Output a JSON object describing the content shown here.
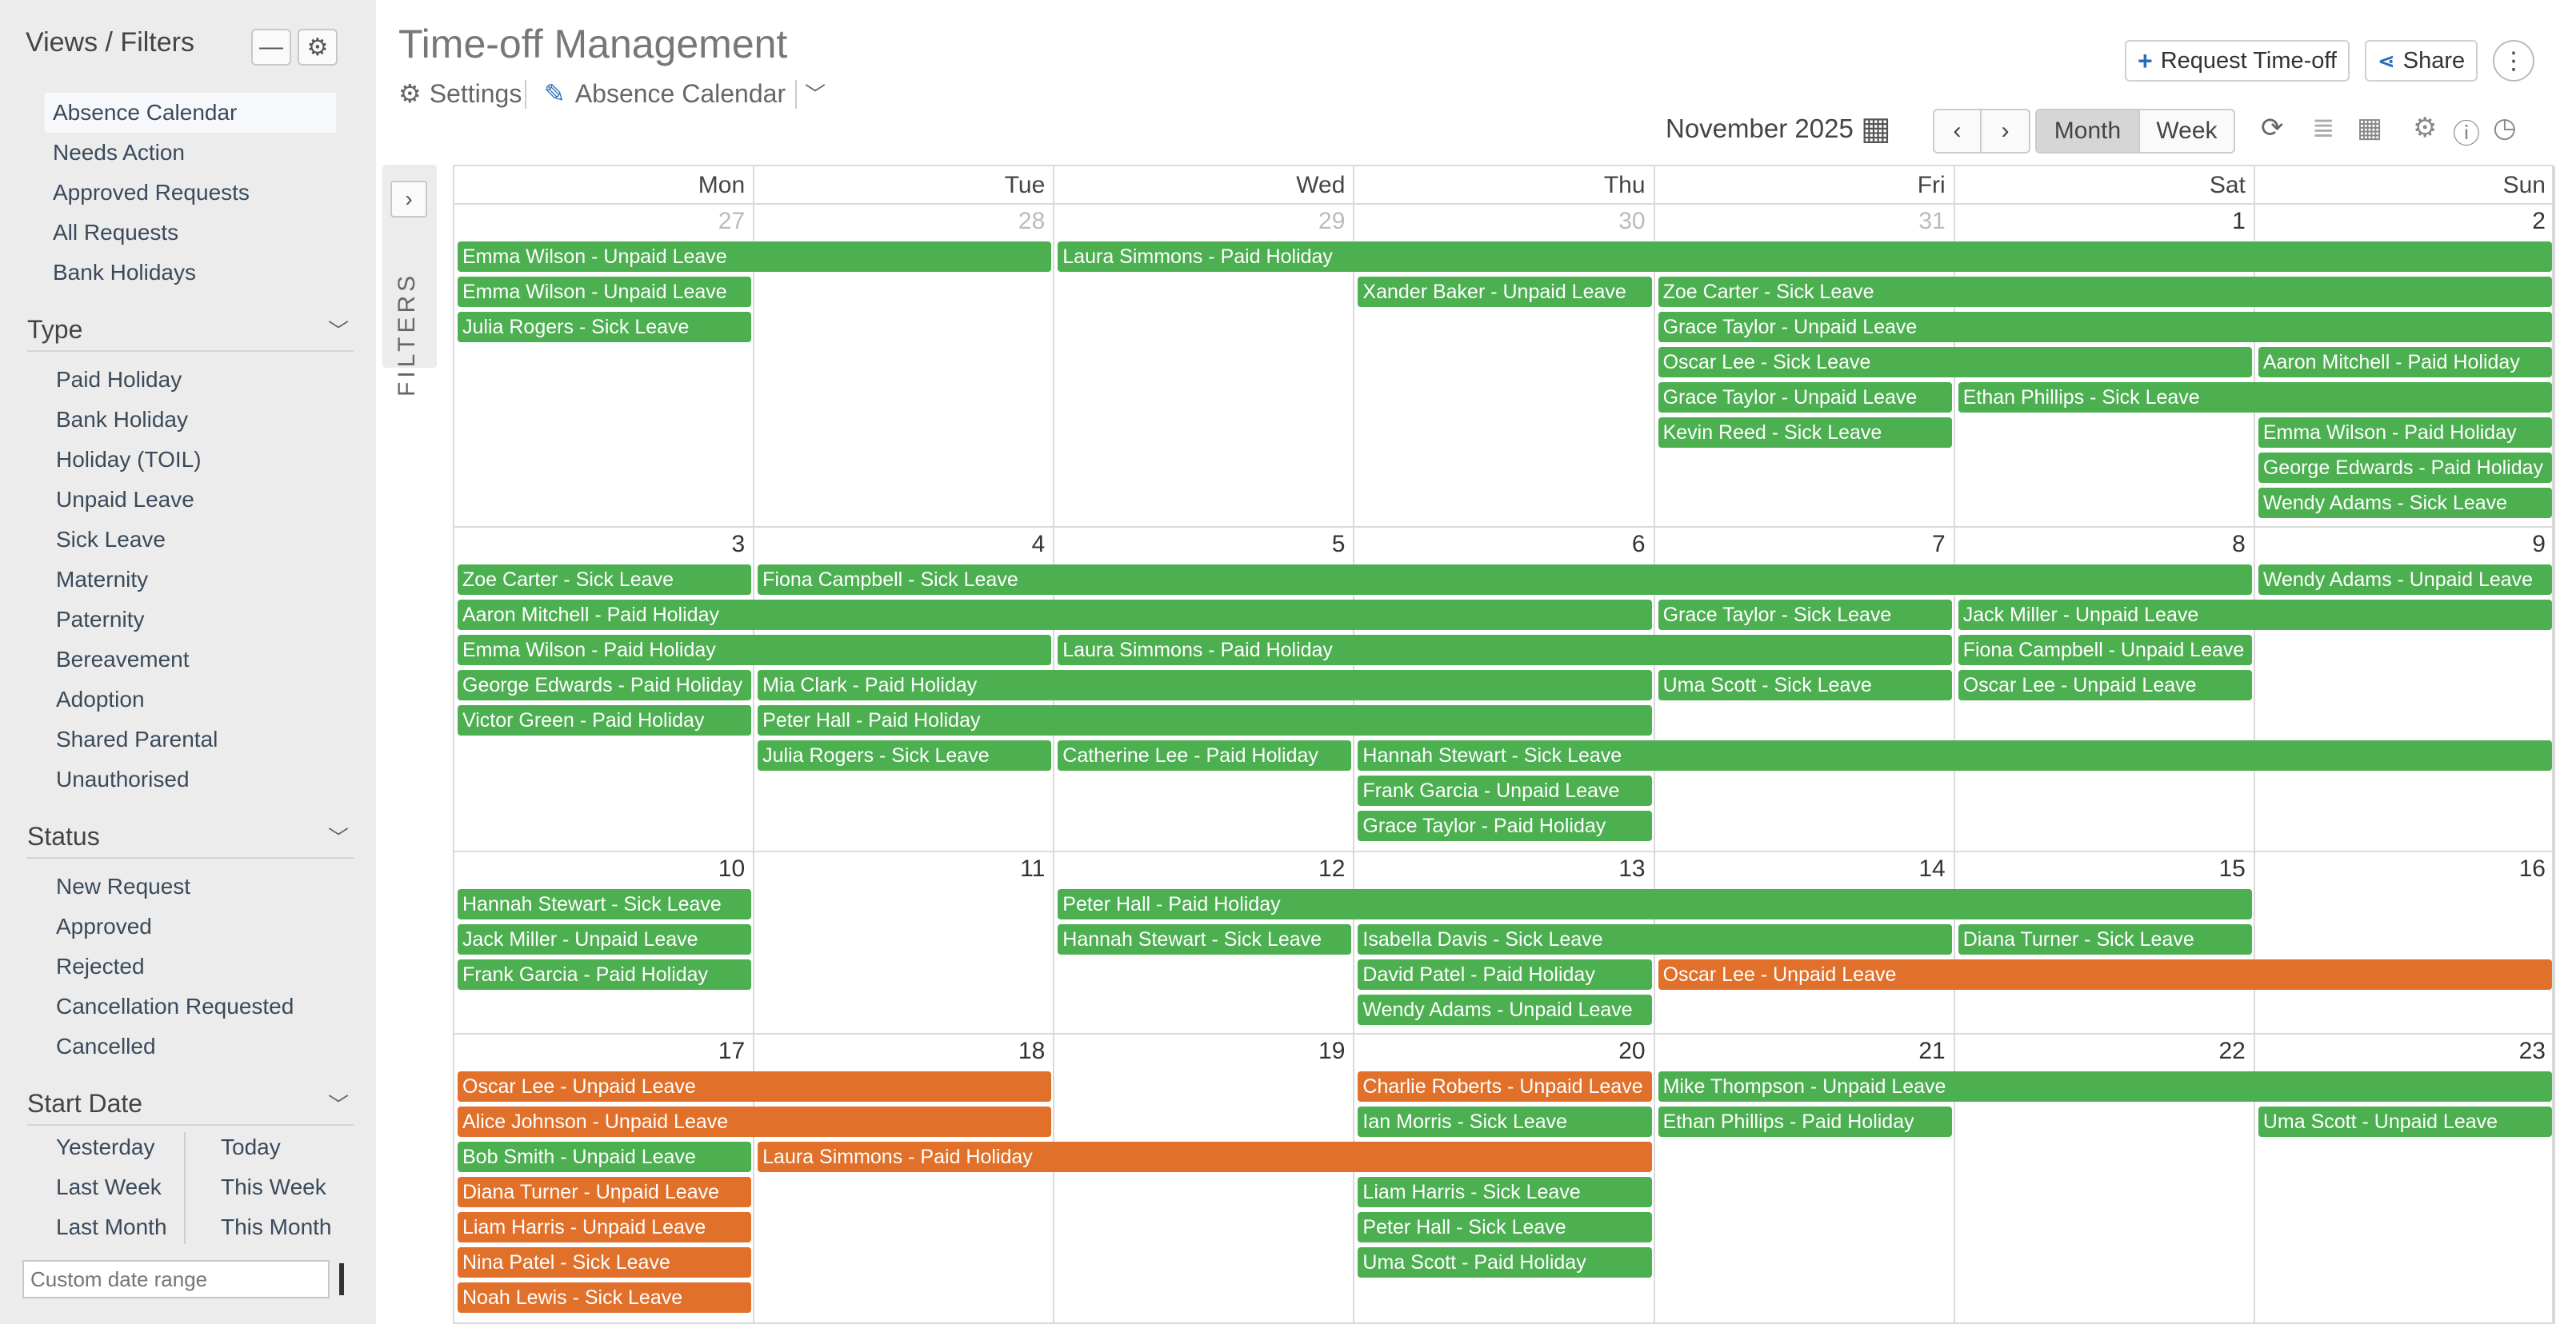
{
  "sidebar": {
    "title": "Views / Filters",
    "views": [
      "Absence Calendar",
      "Needs Action",
      "Approved Requests",
      "All Requests",
      "Bank Holidays"
    ],
    "type_title": "Type",
    "types": [
      "Paid Holiday",
      "Bank Holiday",
      "Holiday (TOIL)",
      "Unpaid Leave",
      "Sick Leave",
      "Maternity",
      "Paternity",
      "Bereavement",
      "Adoption",
      "Shared Parental",
      "Unauthorised"
    ],
    "status_title": "Status",
    "statuses": [
      "New Request",
      "Approved",
      "Rejected",
      "Cancellation Requested",
      "Cancelled"
    ],
    "start_title": "Start Date",
    "dates_left": [
      "Yesterday",
      "Last Week",
      "Last Month"
    ],
    "dates_right": [
      "Today",
      "This Week",
      "This Month"
    ],
    "range_placeholder": "Custom date range"
  },
  "filters_tab": {
    "label": "FILTERS"
  },
  "header": {
    "title": "Time-off Management",
    "settings": "Settings",
    "view_name": "Absence Calendar",
    "request_btn": "Request Time-off",
    "share_btn": "Share",
    "month": "November 2025",
    "month_btn": "Month",
    "week_btn": "Week"
  },
  "colors": {
    "approved": "#4caf50",
    "pending": "#e0702a",
    "accent": "#2a6eb5"
  },
  "calendar": {
    "days": [
      "Mon",
      "Tue",
      "Wed",
      "Thu",
      "Fri",
      "Sat",
      "Sun"
    ],
    "weeks": [
      {
        "dates": [
          "27",
          "28",
          "29",
          "30",
          "31",
          "1",
          "2"
        ],
        "muted": [
          true,
          true,
          true,
          true,
          true,
          false,
          false
        ],
        "events": [
          {
            "text": "Emma Wilson - Unpaid Leave",
            "start": 0,
            "span": 2,
            "slot": 0,
            "color": "green"
          },
          {
            "text": "Laura Simmons - Paid Holiday",
            "start": 2,
            "span": 5,
            "slot": 0,
            "color": "green"
          },
          {
            "text": "Emma Wilson - Unpaid Leave",
            "start": 0,
            "span": 1,
            "slot": 1,
            "color": "green"
          },
          {
            "text": "Xander Baker - Unpaid Leave",
            "start": 3,
            "span": 1,
            "slot": 1,
            "color": "green"
          },
          {
            "text": "Zoe Carter - Sick Leave",
            "start": 4,
            "span": 3,
            "slot": 1,
            "color": "green"
          },
          {
            "text": "Julia Rogers - Sick Leave",
            "start": 0,
            "span": 1,
            "slot": 2,
            "color": "green"
          },
          {
            "text": "Grace Taylor - Unpaid Leave",
            "start": 4,
            "span": 3,
            "slot": 2,
            "color": "green"
          },
          {
            "text": "Oscar Lee - Sick Leave",
            "start": 4,
            "span": 2,
            "slot": 3,
            "color": "green"
          },
          {
            "text": "Aaron Mitchell - Paid Holiday",
            "start": 6,
            "span": 1,
            "slot": 3,
            "color": "green"
          },
          {
            "text": "Grace Taylor - Unpaid Leave",
            "start": 4,
            "span": 1,
            "slot": 4,
            "color": "green"
          },
          {
            "text": "Ethan Phillips - Sick Leave",
            "start": 5,
            "span": 2,
            "slot": 4,
            "color": "green"
          },
          {
            "text": "Kevin Reed - Sick Leave",
            "start": 4,
            "span": 1,
            "slot": 5,
            "color": "green"
          },
          {
            "text": "Emma Wilson - Paid Holiday",
            "start": 6,
            "span": 1,
            "slot": 5,
            "color": "green"
          },
          {
            "text": "George Edwards - Paid Holiday",
            "start": 6,
            "span": 1,
            "slot": 6,
            "color": "green"
          },
          {
            "text": "Wendy Adams - Sick Leave",
            "start": 6,
            "span": 1,
            "slot": 7,
            "color": "green"
          }
        ]
      },
      {
        "dates": [
          "3",
          "4",
          "5",
          "6",
          "7",
          "8",
          "9"
        ],
        "muted": [
          false,
          false,
          false,
          false,
          false,
          false,
          false
        ],
        "events": [
          {
            "text": "Zoe Carter - Sick Leave",
            "start": 0,
            "span": 1,
            "slot": 0,
            "color": "green"
          },
          {
            "text": "Fiona Campbell - Sick Leave",
            "start": 1,
            "span": 5,
            "slot": 0,
            "color": "green"
          },
          {
            "text": "Wendy Adams - Unpaid Leave",
            "start": 6,
            "span": 1,
            "slot": 0,
            "color": "green"
          },
          {
            "text": "Aaron Mitchell - Paid Holiday",
            "start": 0,
            "span": 4,
            "slot": 1,
            "color": "green"
          },
          {
            "text": "Grace Taylor - Sick Leave",
            "start": 4,
            "span": 1,
            "slot": 1,
            "color": "green"
          },
          {
            "text": "Jack Miller - Unpaid Leave",
            "start": 5,
            "span": 2,
            "slot": 1,
            "color": "green"
          },
          {
            "text": "Emma Wilson - Paid Holiday",
            "start": 0,
            "span": 2,
            "slot": 2,
            "color": "green"
          },
          {
            "text": "Laura Simmons - Paid Holiday",
            "start": 2,
            "span": 3,
            "slot": 2,
            "color": "green"
          },
          {
            "text": "Fiona Campbell - Unpaid Leave",
            "start": 5,
            "span": 1,
            "slot": 2,
            "color": "green"
          },
          {
            "text": "George Edwards - Paid Holiday",
            "start": 0,
            "span": 1,
            "slot": 3,
            "color": "green"
          },
          {
            "text": "Mia Clark - Paid Holiday",
            "start": 1,
            "span": 3,
            "slot": 3,
            "color": "green"
          },
          {
            "text": "Uma Scott - Sick Leave",
            "start": 4,
            "span": 1,
            "slot": 3,
            "color": "green"
          },
          {
            "text": "Oscar Lee - Unpaid Leave",
            "start": 5,
            "span": 1,
            "slot": 3,
            "color": "green"
          },
          {
            "text": "Victor Green - Paid Holiday",
            "start": 0,
            "span": 1,
            "slot": 4,
            "color": "green"
          },
          {
            "text": "Peter Hall - Paid Holiday",
            "start": 1,
            "span": 3,
            "slot": 4,
            "color": "green"
          },
          {
            "text": "Julia Rogers - Sick Leave",
            "start": 1,
            "span": 1,
            "slot": 5,
            "color": "green"
          },
          {
            "text": "Catherine Lee - Paid Holiday",
            "start": 2,
            "span": 1,
            "slot": 5,
            "color": "green"
          },
          {
            "text": "Hannah Stewart - Sick Leave",
            "start": 3,
            "span": 4,
            "slot": 5,
            "color": "green"
          },
          {
            "text": "Frank Garcia - Unpaid Leave",
            "start": 3,
            "span": 1,
            "slot": 6,
            "color": "green"
          },
          {
            "text": "Grace Taylor - Paid Holiday",
            "start": 3,
            "span": 1,
            "slot": 7,
            "color": "green"
          }
        ]
      },
      {
        "dates": [
          "10",
          "11",
          "12",
          "13",
          "14",
          "15",
          "16"
        ],
        "muted": [
          false,
          false,
          false,
          false,
          false,
          false,
          false
        ],
        "events": [
          {
            "text": "Hannah Stewart - Sick Leave",
            "start": 0,
            "span": 1,
            "slot": 0,
            "color": "green"
          },
          {
            "text": "Peter Hall - Paid Holiday",
            "start": 2,
            "span": 4,
            "slot": 0,
            "color": "green"
          },
          {
            "text": "Jack Miller - Unpaid Leave",
            "start": 0,
            "span": 1,
            "slot": 1,
            "color": "green"
          },
          {
            "text": "Hannah Stewart - Sick Leave",
            "start": 2,
            "span": 1,
            "slot": 1,
            "color": "green"
          },
          {
            "text": "Isabella Davis - Sick Leave",
            "start": 3,
            "span": 2,
            "slot": 1,
            "color": "green"
          },
          {
            "text": "Diana Turner - Sick Leave",
            "start": 5,
            "span": 1,
            "slot": 1,
            "color": "green"
          },
          {
            "text": "Frank Garcia - Paid Holiday",
            "start": 0,
            "span": 1,
            "slot": 2,
            "color": "green"
          },
          {
            "text": "David Patel - Paid Holiday",
            "start": 3,
            "span": 1,
            "slot": 2,
            "color": "green"
          },
          {
            "text": "Oscar Lee - Unpaid Leave",
            "start": 4,
            "span": 3,
            "slot": 2,
            "color": "orange"
          },
          {
            "text": "Wendy Adams - Unpaid Leave",
            "start": 3,
            "span": 1,
            "slot": 3,
            "color": "green"
          }
        ]
      },
      {
        "dates": [
          "17",
          "18",
          "19",
          "20",
          "21",
          "22",
          "23"
        ],
        "muted": [
          false,
          false,
          false,
          false,
          false,
          false,
          false
        ],
        "events": [
          {
            "text": "Oscar Lee - Unpaid Leave",
            "start": 0,
            "span": 2,
            "slot": 0,
            "color": "orange"
          },
          {
            "text": "Charlie Roberts - Unpaid Leave",
            "start": 3,
            "span": 1,
            "slot": 0,
            "color": "orange"
          },
          {
            "text": "Mike Thompson - Unpaid Leave",
            "start": 4,
            "span": 3,
            "slot": 0,
            "color": "green"
          },
          {
            "text": "Alice Johnson - Unpaid Leave",
            "start": 0,
            "span": 2,
            "slot": 1,
            "color": "orange"
          },
          {
            "text": "Ian Morris - Sick Leave",
            "start": 3,
            "span": 1,
            "slot": 1,
            "color": "green"
          },
          {
            "text": "Ethan Phillips - Paid Holiday",
            "start": 4,
            "span": 1,
            "slot": 1,
            "color": "green"
          },
          {
            "text": "Uma Scott - Unpaid Leave",
            "start": 6,
            "span": 1,
            "slot": 1,
            "color": "green"
          },
          {
            "text": "Bob Smith - Unpaid Leave",
            "start": 0,
            "span": 1,
            "slot": 2,
            "color": "green"
          },
          {
            "text": "Laura Simmons - Paid Holiday",
            "start": 1,
            "span": 3,
            "slot": 2,
            "color": "orange"
          },
          {
            "text": "Diana Turner - Unpaid Leave",
            "start": 0,
            "span": 1,
            "slot": 3,
            "color": "orange"
          },
          {
            "text": "Liam Harris - Sick Leave",
            "start": 3,
            "span": 1,
            "slot": 3,
            "color": "green"
          },
          {
            "text": "Liam Harris - Unpaid Leave",
            "start": 0,
            "span": 1,
            "slot": 4,
            "color": "orange"
          },
          {
            "text": "Peter Hall - Sick Leave",
            "start": 3,
            "span": 1,
            "slot": 4,
            "color": "green"
          },
          {
            "text": "Nina Patel - Sick Leave",
            "start": 0,
            "span": 1,
            "slot": 5,
            "color": "orange"
          },
          {
            "text": "Uma Scott - Paid Holiday",
            "start": 3,
            "span": 1,
            "slot": 5,
            "color": "green"
          },
          {
            "text": "Noah Lewis - Sick Leave",
            "start": 0,
            "span": 1,
            "slot": 6,
            "color": "orange"
          }
        ]
      }
    ]
  }
}
